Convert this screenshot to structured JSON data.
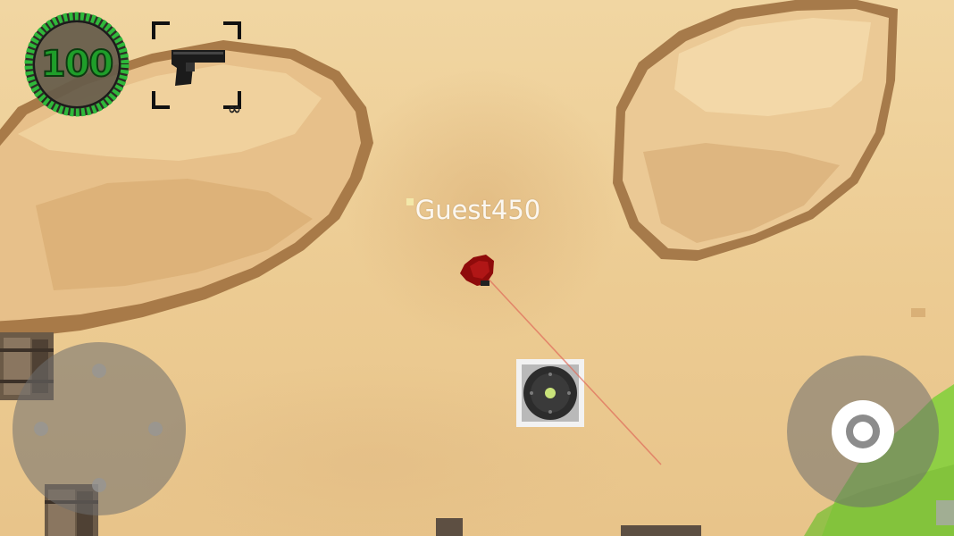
{
  "hud": {
    "health": {
      "value": "100",
      "level": 1.0,
      "color": "#1f9e2a"
    },
    "weapon": {
      "icon": "pistol-icon",
      "ammo": "∞"
    },
    "player_name": "Guest450"
  },
  "controls": {
    "move_joystick": "move-joystick",
    "fire_button": "fire-button-icon"
  },
  "world": {
    "ground_color": "#eecf98",
    "rock_color": "#dcae72",
    "grass_color": "#8fcf45",
    "aim_line_color": "#e06b5a",
    "blood_color": "#8f0b0b"
  }
}
